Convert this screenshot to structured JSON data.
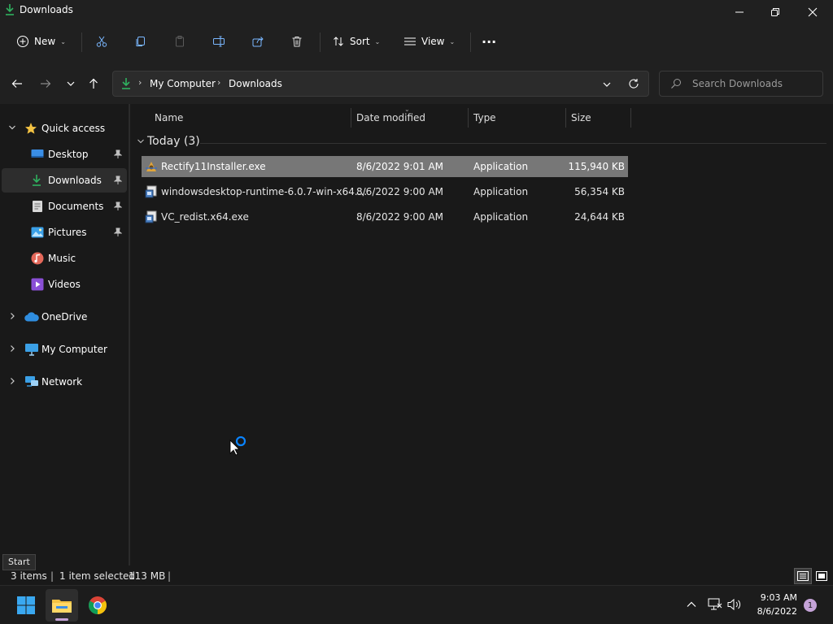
{
  "window": {
    "title": "Downloads"
  },
  "toolbar": {
    "new_label": "New",
    "sort_label": "Sort",
    "view_label": "View",
    "more_label": "···"
  },
  "address": {
    "segments": [
      "My Computer",
      "Downloads"
    ],
    "search_placeholder": "Search Downloads"
  },
  "nav": {
    "quick_access": "Quick access",
    "items": [
      {
        "label": "Desktop",
        "pinned": true
      },
      {
        "label": "Downloads",
        "pinned": true,
        "selected": true
      },
      {
        "label": "Documents",
        "pinned": true
      },
      {
        "label": "Pictures",
        "pinned": true
      },
      {
        "label": "Music",
        "pinned": false
      },
      {
        "label": "Videos",
        "pinned": false
      }
    ],
    "onedrive": "OneDrive",
    "my_computer": "My Computer",
    "network": "Network"
  },
  "columns": {
    "name": "Name",
    "date": "Date modified",
    "type": "Type",
    "size": "Size"
  },
  "group": {
    "label": "Today (3)"
  },
  "files": [
    {
      "name": "Rectify11Installer.exe",
      "date": "8/6/2022 9:01 AM",
      "type": "Application",
      "size": "115,940 KB",
      "selected": true
    },
    {
      "name": "windowsdesktop-runtime-6.0.7-win-x64....",
      "date": "8/6/2022 9:00 AM",
      "type": "Application",
      "size": "56,354 KB",
      "selected": false
    },
    {
      "name": "VC_redist.x64.exe",
      "date": "8/6/2022 9:00 AM",
      "type": "Application",
      "size": "24,644 KB",
      "selected": false
    }
  ],
  "status": {
    "items": "3 items",
    "selected": "1 item selected",
    "size": "113 MB",
    "separator": "|",
    "tooltip": "Start"
  },
  "taskbar": {
    "time": "9:03 AM",
    "date": "8/6/2022",
    "notification_count": "1"
  },
  "colors": {
    "accent": "#0a84ff",
    "selection": "#777777",
    "folder_yellow": "#f3c243",
    "download_green": "#2fb15f"
  }
}
